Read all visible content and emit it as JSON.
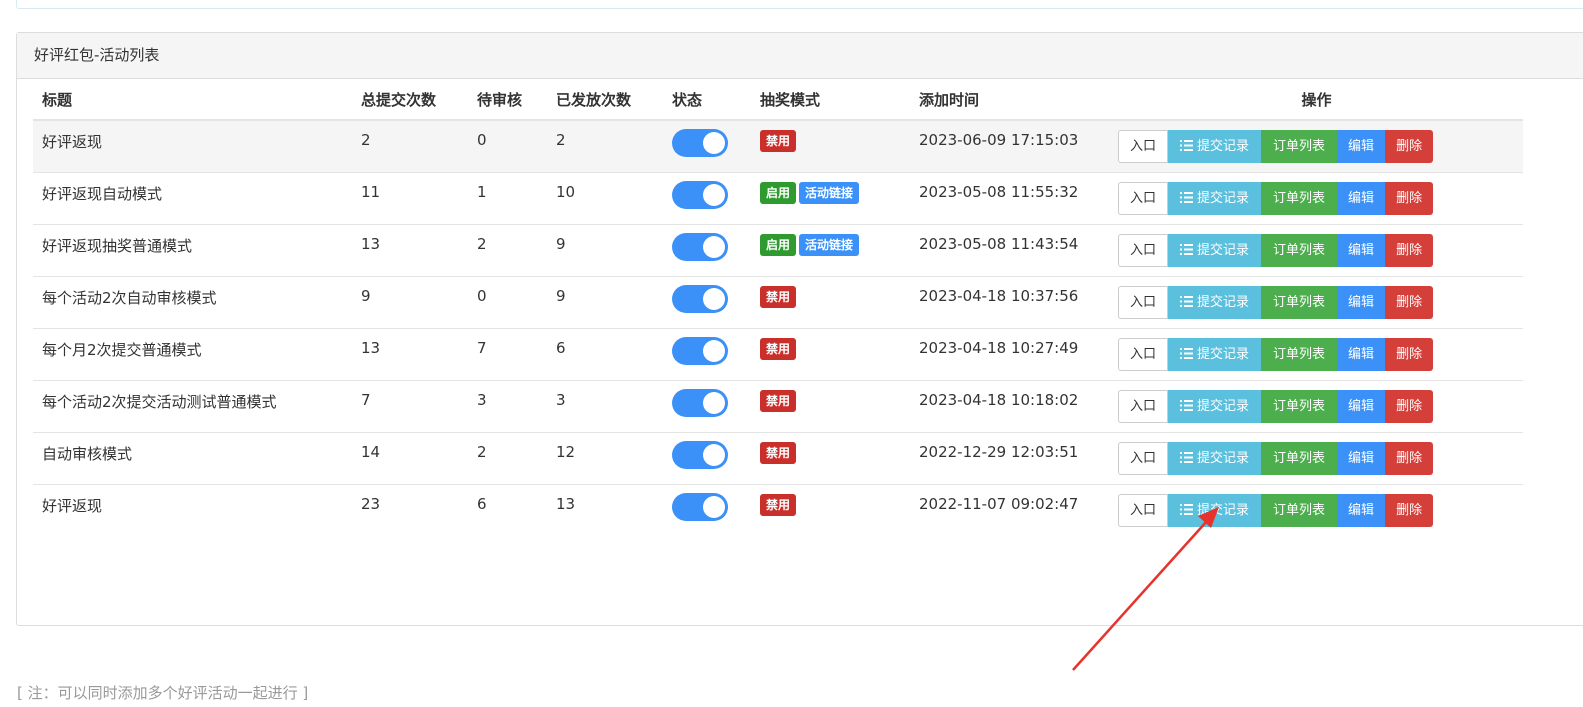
{
  "panel": {
    "title": "好评红包-活动列表"
  },
  "table": {
    "headers": {
      "title": "标题",
      "total": "总提交次数",
      "pending": "待审核",
      "issued": "已发放次数",
      "status": "状态",
      "mode": "抽奖模式",
      "added": "添加时间",
      "ops": "操作"
    },
    "rows": [
      {
        "title": "好评返现",
        "total": "2",
        "pending": "0",
        "issued": "2",
        "status_on": true,
        "mode": "禁用",
        "link": "",
        "added": "2023-06-09 17:15:03"
      },
      {
        "title": "好评返现自动模式",
        "total": "11",
        "pending": "1",
        "issued": "10",
        "status_on": true,
        "mode": "启用",
        "link": "活动链接",
        "added": "2023-05-08 11:55:32"
      },
      {
        "title": "好评返现抽奖普通模式",
        "total": "13",
        "pending": "2",
        "issued": "9",
        "status_on": true,
        "mode": "启用",
        "link": "活动链接",
        "added": "2023-05-08 11:43:54"
      },
      {
        "title": "每个活动2次自动审核模式",
        "total": "9",
        "pending": "0",
        "issued": "9",
        "status_on": true,
        "mode": "禁用",
        "link": "",
        "added": "2023-04-18 10:37:56"
      },
      {
        "title": "每个月2次提交普通模式",
        "total": "13",
        "pending": "7",
        "issued": "6",
        "status_on": true,
        "mode": "禁用",
        "link": "",
        "added": "2023-04-18 10:27:49"
      },
      {
        "title": "每个活动2次提交活动测试普通模式",
        "total": "7",
        "pending": "3",
        "issued": "3",
        "status_on": true,
        "mode": "禁用",
        "link": "",
        "added": "2023-04-18 10:18:02"
      },
      {
        "title": "自动审核模式",
        "total": "14",
        "pending": "2",
        "issued": "12",
        "status_on": true,
        "mode": "禁用",
        "link": "",
        "added": "2022-12-29 12:03:51"
      },
      {
        "title": "好评返现",
        "total": "23",
        "pending": "6",
        "issued": "13",
        "status_on": true,
        "mode": "禁用",
        "link": "",
        "added": "2022-11-07 09:02:47"
      }
    ],
    "actions": {
      "entry": "入口",
      "records": "提交记录",
      "orders": "订单列表",
      "edit": "编辑",
      "delete": "删除"
    }
  },
  "note": "[ 注：可以同时添加多个好评活动一起进行 ]",
  "colors": {
    "toggle_on": "#3b91f7",
    "badge_disabled": "#c9302c",
    "badge_enabled": "#2f9a2f",
    "badge_link": "#3b91f7",
    "btn_records": "#5bc0de",
    "btn_orders": "#4cae4c",
    "btn_edit": "#3b91f7",
    "btn_delete": "#d43f3a",
    "annotation_arrow": "#e8322c"
  }
}
